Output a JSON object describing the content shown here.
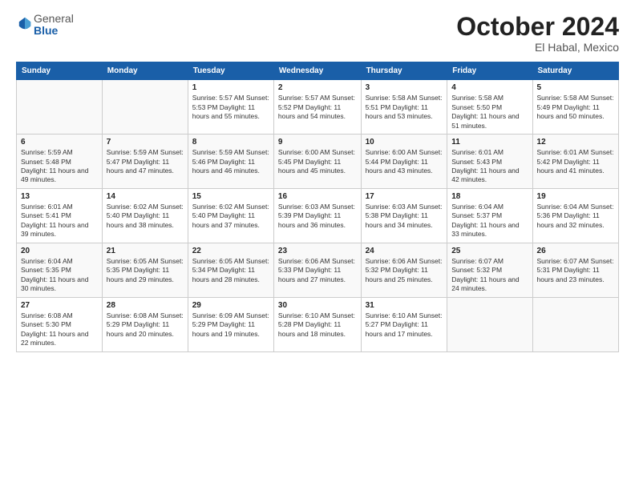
{
  "header": {
    "logo_general": "General",
    "logo_blue": "Blue",
    "month_title": "October 2024",
    "location": "El Habal, Mexico"
  },
  "weekdays": [
    "Sunday",
    "Monday",
    "Tuesday",
    "Wednesday",
    "Thursday",
    "Friday",
    "Saturday"
  ],
  "weeks": [
    [
      {
        "day": "",
        "info": ""
      },
      {
        "day": "",
        "info": ""
      },
      {
        "day": "1",
        "info": "Sunrise: 5:57 AM\nSunset: 5:53 PM\nDaylight: 11 hours and 55 minutes."
      },
      {
        "day": "2",
        "info": "Sunrise: 5:57 AM\nSunset: 5:52 PM\nDaylight: 11 hours and 54 minutes."
      },
      {
        "day": "3",
        "info": "Sunrise: 5:58 AM\nSunset: 5:51 PM\nDaylight: 11 hours and 53 minutes."
      },
      {
        "day": "4",
        "info": "Sunrise: 5:58 AM\nSunset: 5:50 PM\nDaylight: 11 hours and 51 minutes."
      },
      {
        "day": "5",
        "info": "Sunrise: 5:58 AM\nSunset: 5:49 PM\nDaylight: 11 hours and 50 minutes."
      }
    ],
    [
      {
        "day": "6",
        "info": "Sunrise: 5:59 AM\nSunset: 5:48 PM\nDaylight: 11 hours and 49 minutes."
      },
      {
        "day": "7",
        "info": "Sunrise: 5:59 AM\nSunset: 5:47 PM\nDaylight: 11 hours and 47 minutes."
      },
      {
        "day": "8",
        "info": "Sunrise: 5:59 AM\nSunset: 5:46 PM\nDaylight: 11 hours and 46 minutes."
      },
      {
        "day": "9",
        "info": "Sunrise: 6:00 AM\nSunset: 5:45 PM\nDaylight: 11 hours and 45 minutes."
      },
      {
        "day": "10",
        "info": "Sunrise: 6:00 AM\nSunset: 5:44 PM\nDaylight: 11 hours and 43 minutes."
      },
      {
        "day": "11",
        "info": "Sunrise: 6:01 AM\nSunset: 5:43 PM\nDaylight: 11 hours and 42 minutes."
      },
      {
        "day": "12",
        "info": "Sunrise: 6:01 AM\nSunset: 5:42 PM\nDaylight: 11 hours and 41 minutes."
      }
    ],
    [
      {
        "day": "13",
        "info": "Sunrise: 6:01 AM\nSunset: 5:41 PM\nDaylight: 11 hours and 39 minutes."
      },
      {
        "day": "14",
        "info": "Sunrise: 6:02 AM\nSunset: 5:40 PM\nDaylight: 11 hours and 38 minutes."
      },
      {
        "day": "15",
        "info": "Sunrise: 6:02 AM\nSunset: 5:40 PM\nDaylight: 11 hours and 37 minutes."
      },
      {
        "day": "16",
        "info": "Sunrise: 6:03 AM\nSunset: 5:39 PM\nDaylight: 11 hours and 36 minutes."
      },
      {
        "day": "17",
        "info": "Sunrise: 6:03 AM\nSunset: 5:38 PM\nDaylight: 11 hours and 34 minutes."
      },
      {
        "day": "18",
        "info": "Sunrise: 6:04 AM\nSunset: 5:37 PM\nDaylight: 11 hours and 33 minutes."
      },
      {
        "day": "19",
        "info": "Sunrise: 6:04 AM\nSunset: 5:36 PM\nDaylight: 11 hours and 32 minutes."
      }
    ],
    [
      {
        "day": "20",
        "info": "Sunrise: 6:04 AM\nSunset: 5:35 PM\nDaylight: 11 hours and 30 minutes."
      },
      {
        "day": "21",
        "info": "Sunrise: 6:05 AM\nSunset: 5:35 PM\nDaylight: 11 hours and 29 minutes."
      },
      {
        "day": "22",
        "info": "Sunrise: 6:05 AM\nSunset: 5:34 PM\nDaylight: 11 hours and 28 minutes."
      },
      {
        "day": "23",
        "info": "Sunrise: 6:06 AM\nSunset: 5:33 PM\nDaylight: 11 hours and 27 minutes."
      },
      {
        "day": "24",
        "info": "Sunrise: 6:06 AM\nSunset: 5:32 PM\nDaylight: 11 hours and 25 minutes."
      },
      {
        "day": "25",
        "info": "Sunrise: 6:07 AM\nSunset: 5:32 PM\nDaylight: 11 hours and 24 minutes."
      },
      {
        "day": "26",
        "info": "Sunrise: 6:07 AM\nSunset: 5:31 PM\nDaylight: 11 hours and 23 minutes."
      }
    ],
    [
      {
        "day": "27",
        "info": "Sunrise: 6:08 AM\nSunset: 5:30 PM\nDaylight: 11 hours and 22 minutes."
      },
      {
        "day": "28",
        "info": "Sunrise: 6:08 AM\nSunset: 5:29 PM\nDaylight: 11 hours and 20 minutes."
      },
      {
        "day": "29",
        "info": "Sunrise: 6:09 AM\nSunset: 5:29 PM\nDaylight: 11 hours and 19 minutes."
      },
      {
        "day": "30",
        "info": "Sunrise: 6:10 AM\nSunset: 5:28 PM\nDaylight: 11 hours and 18 minutes."
      },
      {
        "day": "31",
        "info": "Sunrise: 6:10 AM\nSunset: 5:27 PM\nDaylight: 11 hours and 17 minutes."
      },
      {
        "day": "",
        "info": ""
      },
      {
        "day": "",
        "info": ""
      }
    ]
  ]
}
